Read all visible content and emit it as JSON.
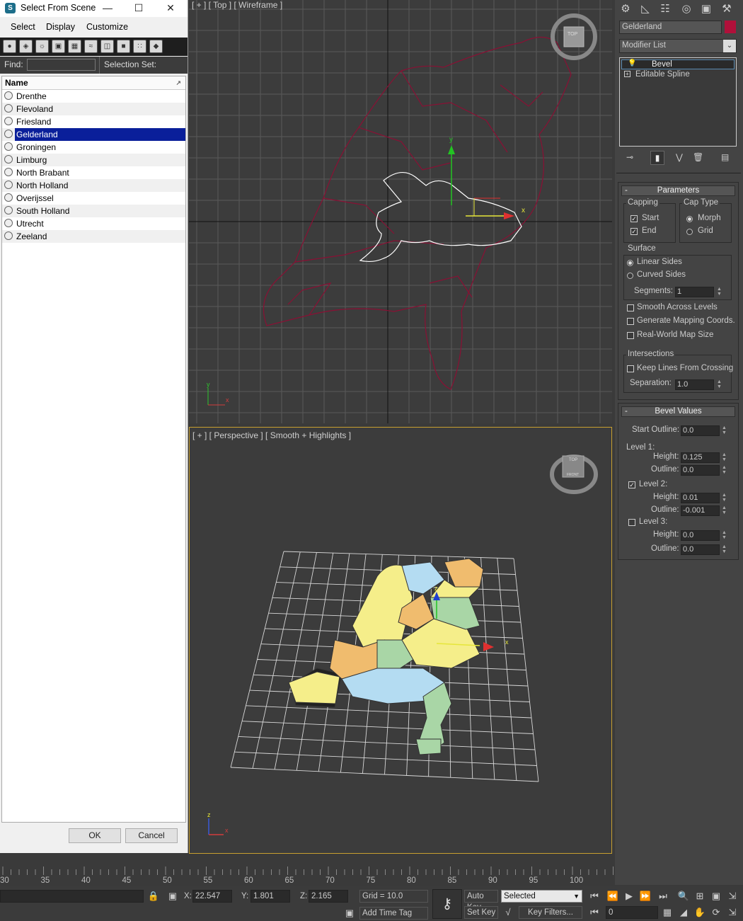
{
  "dialog": {
    "title": "Select From Scene",
    "menu": [
      "Select",
      "Display",
      "Customize"
    ],
    "find_label": "Find:",
    "find_value": "",
    "selection_set_label": "Selection Set:",
    "column_header": "Name",
    "items": [
      "Drenthe",
      "Flevoland",
      "Friesland",
      "Gelderland",
      "Groningen",
      "Limburg",
      "North Brabant",
      "North Holland",
      "Overijssel",
      "South Holland",
      "Utrecht",
      "Zeeland"
    ],
    "selected_item": "Gelderland",
    "ok_label": "OK",
    "cancel_label": "Cancel"
  },
  "viewports": {
    "top_label": "[ + ] [ Top ] [ Wireframe ]",
    "perspective_label": "[ + ] [ Perspective ] [ Smooth + Highlights ]",
    "viewcube_top": "TOP",
    "viewcube_persp_top": "TOP",
    "viewcube_persp_front": "FRONT"
  },
  "command_panel": {
    "object_name": "Gelderland",
    "object_color": "#b0103a",
    "modifier_list_label": "Modifier List",
    "stack": [
      "Bevel",
      "Editable Spline"
    ],
    "parameters": {
      "title": "Parameters",
      "capping_label": "Capping",
      "start_label": "Start",
      "start_checked": true,
      "end_label": "End",
      "end_checked": true,
      "cap_type_label": "Cap Type",
      "morph_label": "Morph",
      "grid_label": "Grid",
      "cap_type_selected": "Morph",
      "surface_label": "Surface",
      "linear_sides_label": "Linear Sides",
      "curved_sides_label": "Curved Sides",
      "surface_selected": "Linear Sides",
      "segments_label": "Segments:",
      "segments_value": "1",
      "smooth_across_label": "Smooth Across Levels",
      "gen_mapping_label": "Generate Mapping Coords.",
      "real_world_label": "Real-World Map Size",
      "intersections_label": "Intersections",
      "keep_lines_label": "Keep Lines From Crossing",
      "separation_label": "Separation:",
      "separation_value": "1.0"
    },
    "bevel_values": {
      "title": "Bevel Values",
      "start_outline_label": "Start Outline:",
      "start_outline_value": "0.0",
      "level1_label": "Level 1:",
      "l1_height_label": "Height:",
      "l1_height_value": "0.125",
      "l1_outline_label": "Outline:",
      "l1_outline_value": "0.0",
      "level2_label": "Level 2:",
      "level2_checked": true,
      "l2_height_label": "Height:",
      "l2_height_value": "0.01",
      "l2_outline_label": "Outline:",
      "l2_outline_value": "-0.001",
      "level3_label": "Level 3:",
      "level3_checked": false,
      "l3_height_label": "Height:",
      "l3_height_value": "0.0",
      "l3_outline_label": "Outline:",
      "l3_outline_value": "0.0"
    }
  },
  "timeline": {
    "ticks": [
      "30",
      "35",
      "40",
      "45",
      "50",
      "55",
      "60",
      "65",
      "70",
      "75",
      "80",
      "85",
      "90",
      "95",
      "100"
    ]
  },
  "status": {
    "x_label": "X:",
    "x_value": "22.547",
    "y_label": "Y:",
    "y_value": "1.801",
    "z_label": "Z:",
    "z_value": "2.165",
    "grid_text": "Grid = 10.0",
    "add_time_tag": "Add Time Tag",
    "auto_key": "Auto Key",
    "set_key": "Set Key",
    "selected_dropdown": "Selected",
    "key_filters": "Key Filters...",
    "frame_value": "0"
  },
  "colors": {
    "selection_blue": "#0a1f9a",
    "spline_red": "#8a1034",
    "yellow_region": "#f5ee8a",
    "blue_region": "#b4dcf2",
    "orange_region": "#f0bc6e",
    "green_region": "#a9d6a6"
  }
}
